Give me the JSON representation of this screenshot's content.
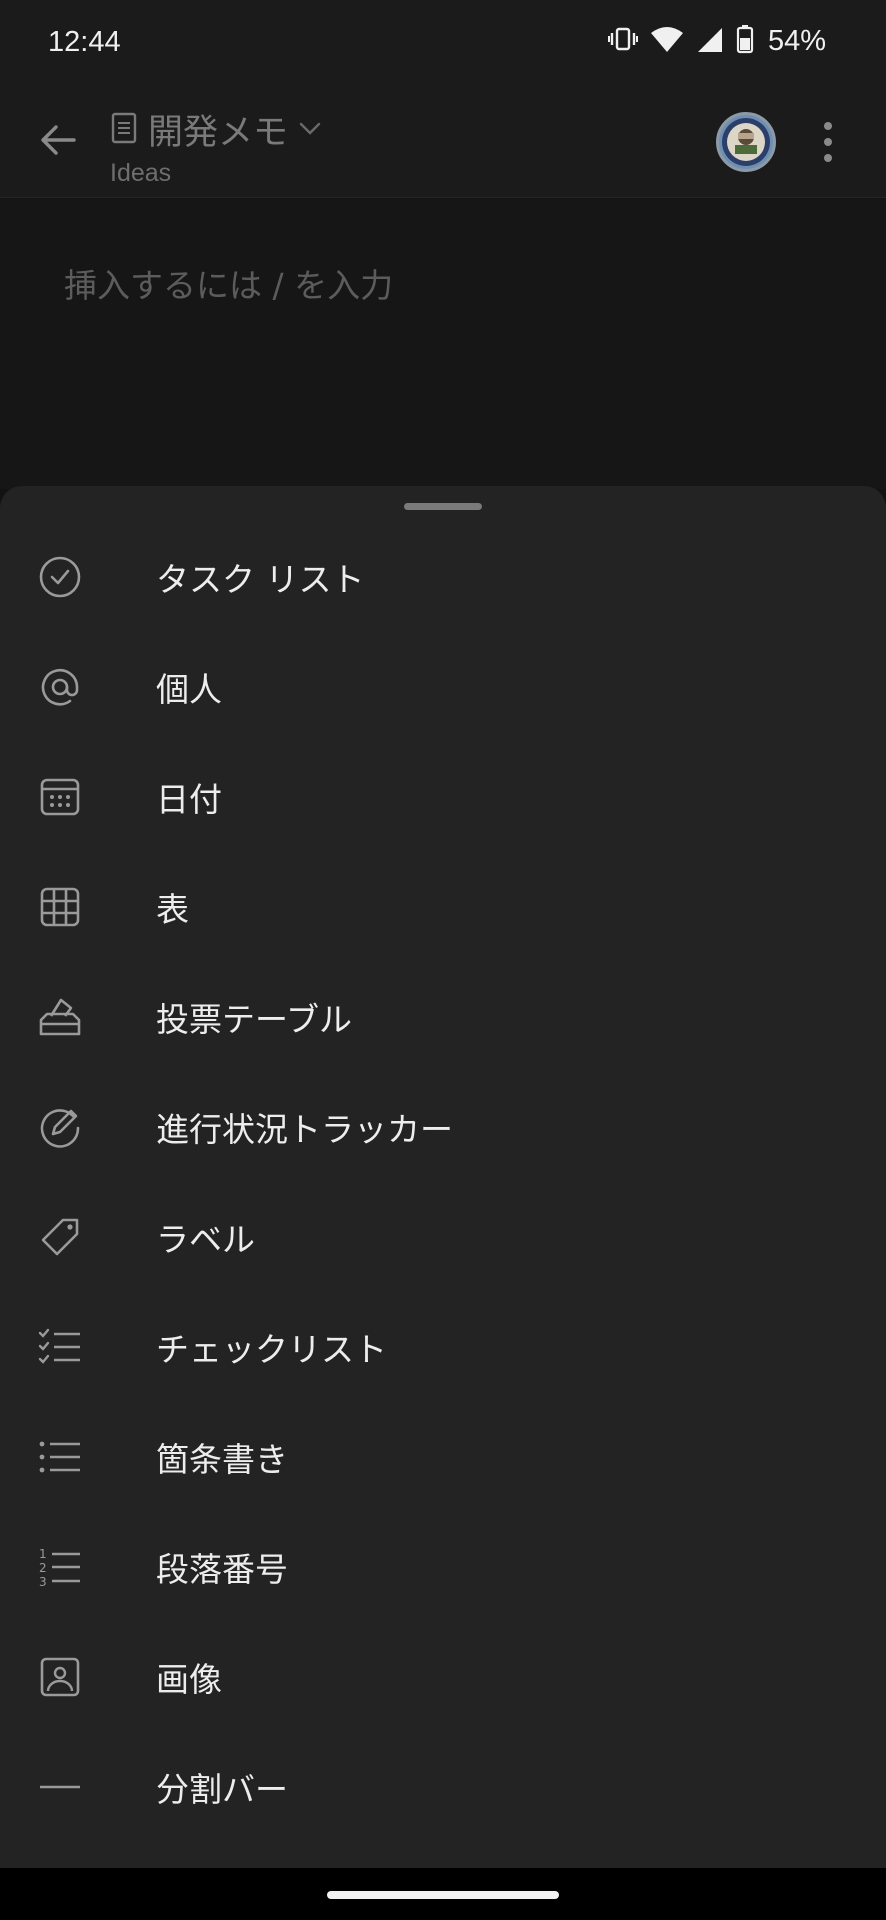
{
  "status": {
    "time": "12:44",
    "battery_percent": "54%",
    "icons": [
      "vibrate-icon",
      "wifi-icon",
      "cell-signal-icon",
      "battery-icon"
    ]
  },
  "header": {
    "title": "開発メモ",
    "subtitle": "Ideas",
    "icons": [
      "back-arrow-icon",
      "page-icon",
      "chevron-down-icon",
      "avatar",
      "more-vert-icon"
    ]
  },
  "editor": {
    "placeholder": "挿入するには / を入力"
  },
  "menu": {
    "items": [
      {
        "label": "タスク リスト",
        "icon": "task-check-circle-icon"
      },
      {
        "label": "個人",
        "icon": "at-sign-icon"
      },
      {
        "label": "日付",
        "icon": "calendar-icon"
      },
      {
        "label": "表",
        "icon": "table-grid-icon"
      },
      {
        "label": "投票テーブル",
        "icon": "ballot-box-icon"
      },
      {
        "label": "進行状況トラッカー",
        "icon": "progress-pencil-circle-icon"
      },
      {
        "label": "ラベル",
        "icon": "tag-icon"
      },
      {
        "label": "チェックリスト",
        "icon": "checklist-icon"
      },
      {
        "label": "箇条書き",
        "icon": "bulleted-list-icon"
      },
      {
        "label": "段落番号",
        "icon": "numbered-list-icon"
      },
      {
        "label": "画像",
        "icon": "image-icon"
      },
      {
        "label": "分割バー",
        "icon": "divider-line-icon"
      }
    ]
  },
  "colors": {
    "background": "#121212",
    "sheet": "#232323",
    "icon_stroke": "#9a9a9a",
    "text_primary": "#ededed"
  }
}
